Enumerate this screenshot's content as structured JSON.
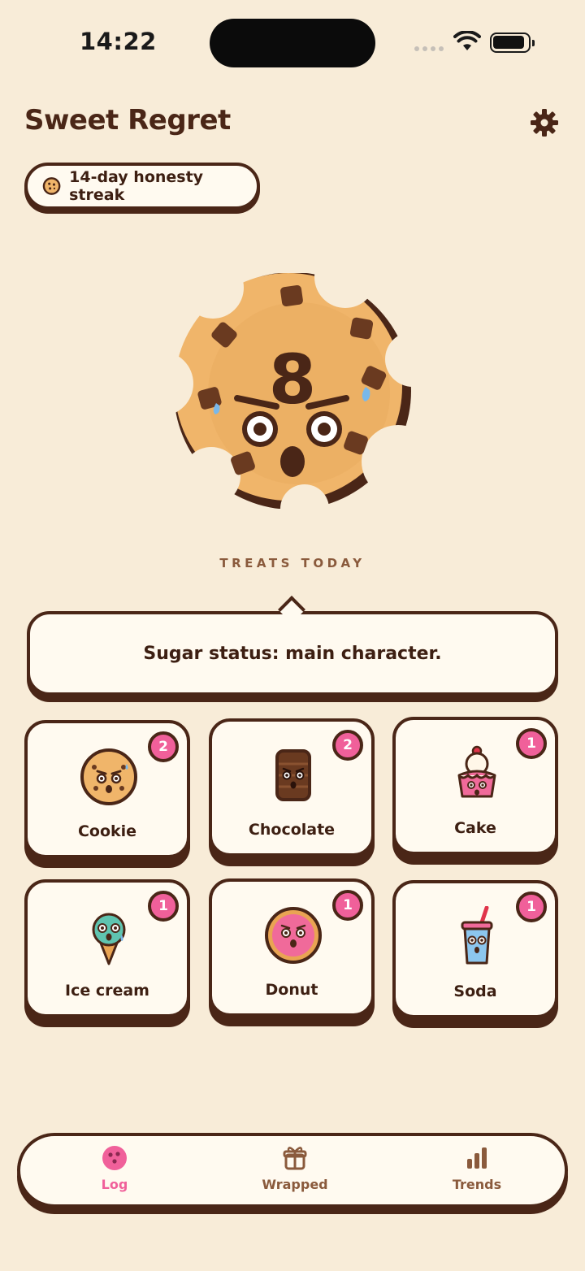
{
  "status_bar": {
    "time": "14:22"
  },
  "header": {
    "title": "Sweet Regret"
  },
  "streak": {
    "label": "14-day honesty streak"
  },
  "mascot": {
    "count": "8"
  },
  "treats_label": "TREATS TODAY",
  "bubble": {
    "text": "Sugar status: main character."
  },
  "treats": [
    {
      "label": "Cookie",
      "count": "2",
      "icon": "cookie-icon"
    },
    {
      "label": "Chocolate",
      "count": "2",
      "icon": "chocolate-icon"
    },
    {
      "label": "Cake",
      "count": "1",
      "icon": "cake-icon"
    },
    {
      "label": "Ice cream",
      "count": "1",
      "icon": "ice-cream-icon"
    },
    {
      "label": "Donut",
      "count": "1",
      "icon": "donut-icon"
    },
    {
      "label": "Soda",
      "count": "1",
      "icon": "soda-icon"
    }
  ],
  "nav": [
    {
      "label": "Log",
      "icon": "log-icon",
      "active": true
    },
    {
      "label": "Wrapped",
      "icon": "gift-icon",
      "active": false
    },
    {
      "label": "Trends",
      "icon": "bar-chart-icon",
      "active": false
    }
  ],
  "colors": {
    "background": "#f8ecd8",
    "outline": "#4a2617",
    "accent_pink": "#f0609a",
    "card": "#fffaf0",
    "muted_brown": "#8a5a3c"
  }
}
